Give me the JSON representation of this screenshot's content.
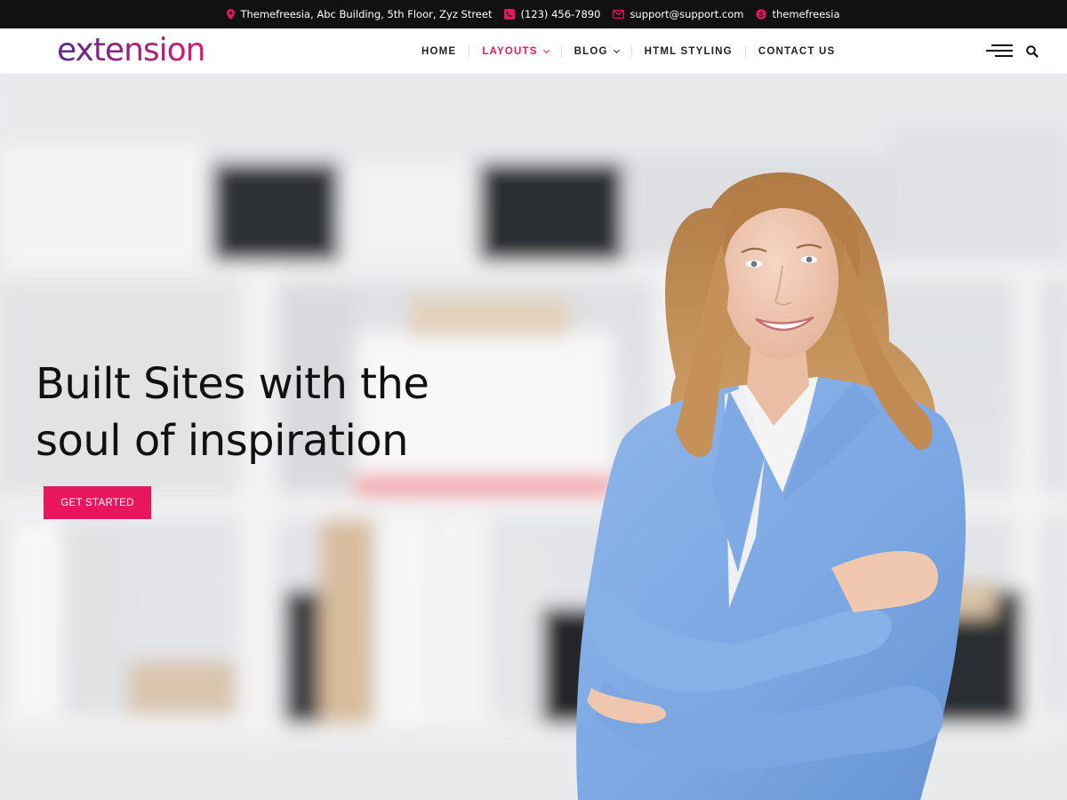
{
  "topbar": {
    "address": "Themefreesia, Abc Building, 5th Floor, Zyz Street",
    "phone": "(123) 456-7890",
    "email": "support@support.com",
    "skype": "themefreesia"
  },
  "header": {
    "logo_text": "extension",
    "nav": [
      {
        "label": "HOME",
        "active": false,
        "has_dropdown": false
      },
      {
        "label": "LAYOUTS",
        "active": true,
        "has_dropdown": true
      },
      {
        "label": "BLOG",
        "active": false,
        "has_dropdown": true
      },
      {
        "label": "HTML STYLING",
        "active": false,
        "has_dropdown": false
      },
      {
        "label": "CONTACT US",
        "active": false,
        "has_dropdown": false
      }
    ]
  },
  "hero": {
    "title_line1": "Built Sites with the",
    "title_line2": "soul of inspiration",
    "cta_label": "GET STARTED"
  },
  "colors": {
    "accent": "#e8175d",
    "topbar_bg": "#111111",
    "logo_gradient_start": "#5a2a8c",
    "logo_gradient_end": "#e0176b"
  },
  "icons": [
    "map-pin-icon",
    "phone-icon",
    "envelope-icon",
    "skype-icon",
    "hamburger-menu-icon",
    "search-icon",
    "chevron-down-icon"
  ]
}
